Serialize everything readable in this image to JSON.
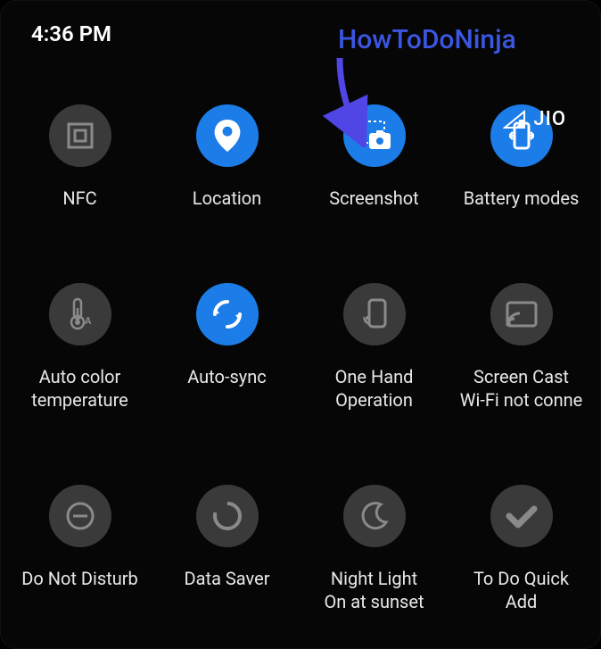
{
  "status": {
    "time": "4:36 PM",
    "carrier": "JIO"
  },
  "annotation": {
    "text": "HowToDoNinja"
  },
  "tiles": {
    "nfc": {
      "label": "NFC"
    },
    "location": {
      "label": "Location"
    },
    "screenshot": {
      "label": "Screenshot"
    },
    "battery": {
      "label": "Battery modes"
    },
    "autocolor": {
      "label": "Auto color\ntemperature"
    },
    "autosync": {
      "label": "Auto-sync"
    },
    "onehand": {
      "label": "One Hand\nOperation"
    },
    "screencast": {
      "label": "Screen Cast\nWi-Fi not conne"
    },
    "dnd": {
      "label": "Do Not Disturb"
    },
    "datasaver": {
      "label": "Data Saver"
    },
    "nightlight": {
      "label": "Night Light\nOn at sunset"
    },
    "todo": {
      "label": "To Do Quick\nAdd"
    }
  }
}
